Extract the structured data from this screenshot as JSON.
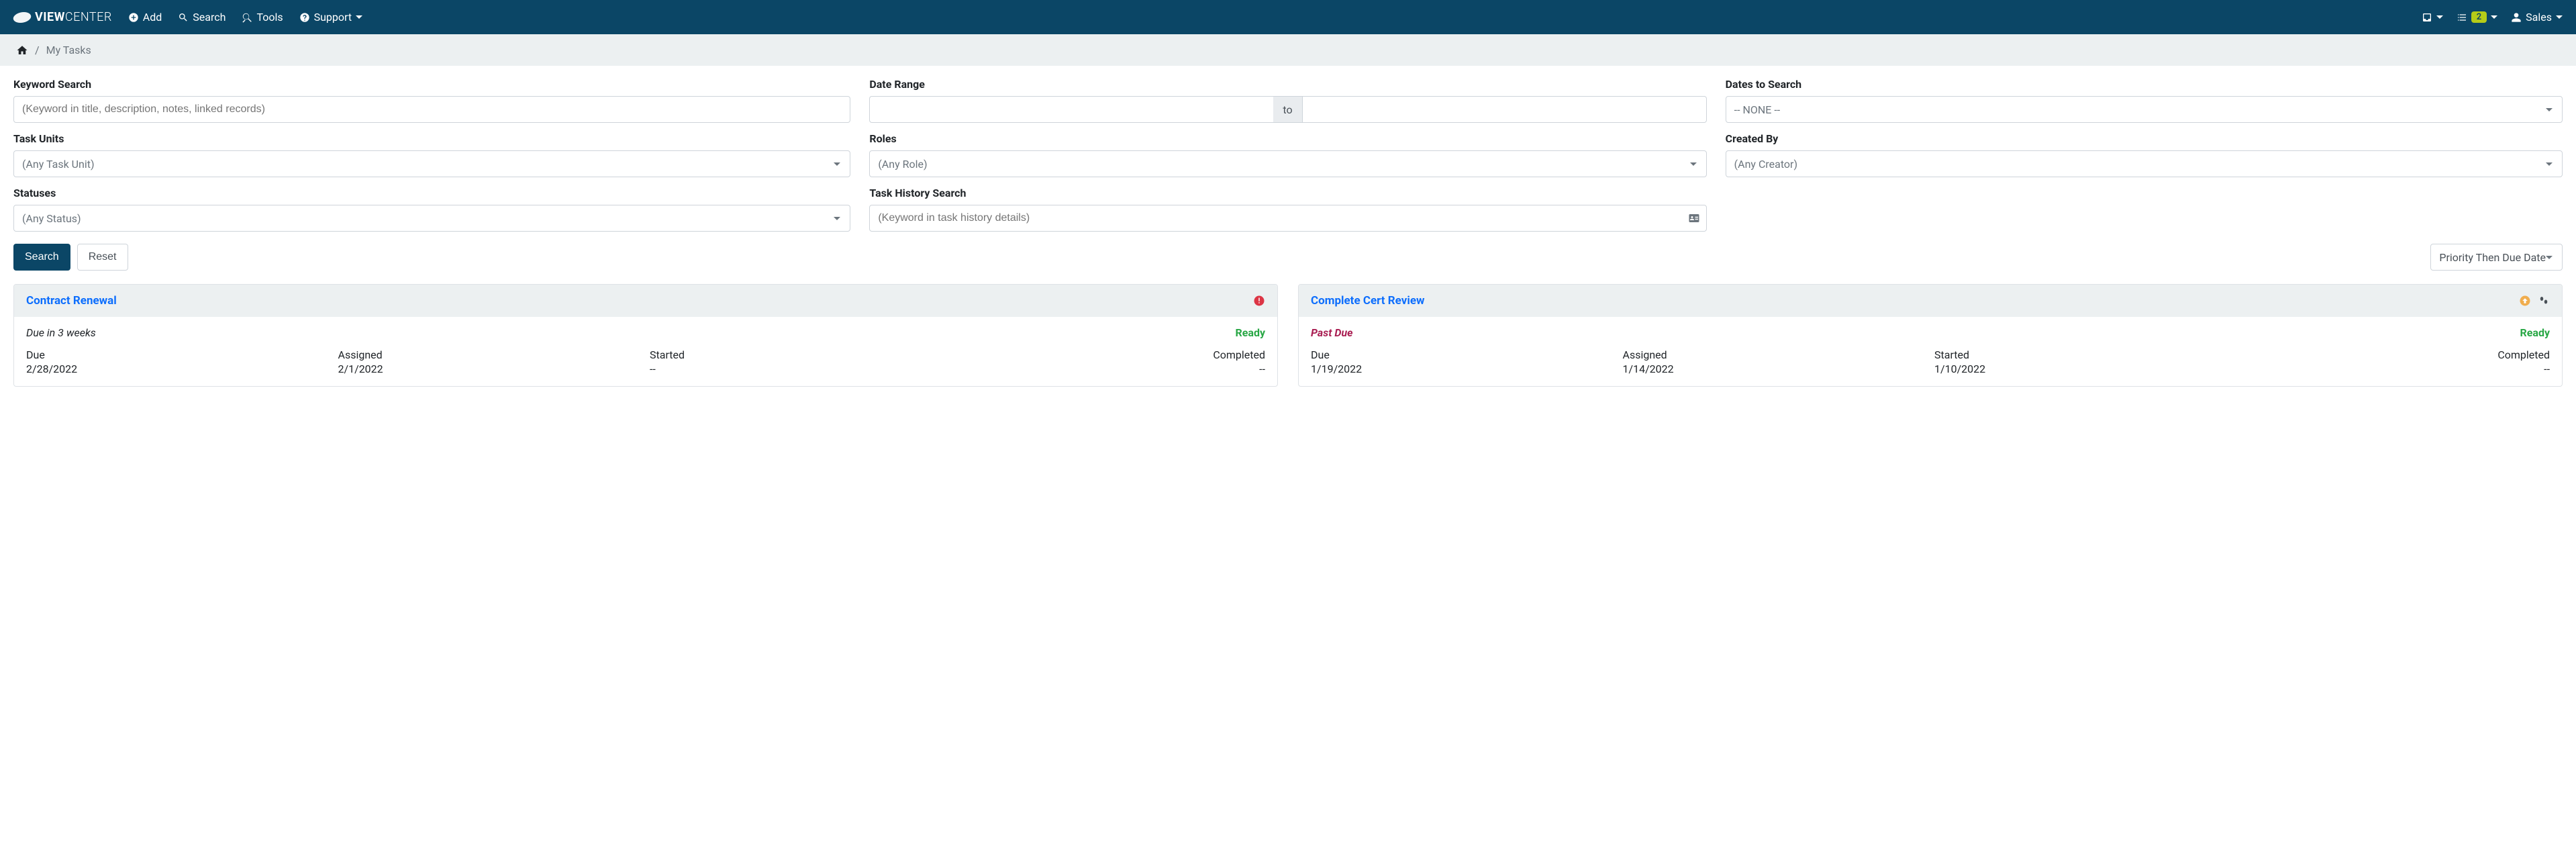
{
  "brand": {
    "part1": "VIEW",
    "part2": "CENTER"
  },
  "nav": {
    "add": "Add",
    "search": "Search",
    "tools": "Tools",
    "support": "Support",
    "user": "Sales",
    "task_count": "2"
  },
  "breadcrumb": {
    "current": "My Tasks"
  },
  "filters": {
    "keyword": {
      "label": "Keyword Search",
      "placeholder": "(Keyword in title, description, notes, linked records)"
    },
    "date_range": {
      "label": "Date Range",
      "to": "to"
    },
    "dates_to_search": {
      "label": "Dates to Search",
      "value": "-- NONE --"
    },
    "task_units": {
      "label": "Task Units",
      "placeholder": "(Any Task Unit)"
    },
    "roles": {
      "label": "Roles",
      "placeholder": "(Any Role)"
    },
    "created_by": {
      "label": "Created By",
      "placeholder": "(Any Creator)"
    },
    "statuses": {
      "label": "Statuses",
      "placeholder": "(Any Status)"
    },
    "task_history": {
      "label": "Task History Search",
      "placeholder": "(Keyword in task history details)"
    }
  },
  "actions": {
    "search": "Search",
    "reset": "Reset",
    "sort": "Priority Then Due Date"
  },
  "cards": [
    {
      "title": "Contract Renewal",
      "due_note": "Due in 3 weeks",
      "past_due": false,
      "status": "Ready",
      "priority": "high",
      "due": "2/28/2022",
      "assigned": "2/1/2022",
      "started": "--",
      "completed": "--"
    },
    {
      "title": "Complete Cert Review",
      "due_note": "Past Due",
      "past_due": true,
      "status": "Ready",
      "priority": "medium",
      "due": "1/19/2022",
      "assigned": "1/14/2022",
      "started": "1/10/2022",
      "completed": "--"
    }
  ],
  "meta_labels": {
    "due": "Due",
    "assigned": "Assigned",
    "started": "Started",
    "completed": "Completed"
  }
}
